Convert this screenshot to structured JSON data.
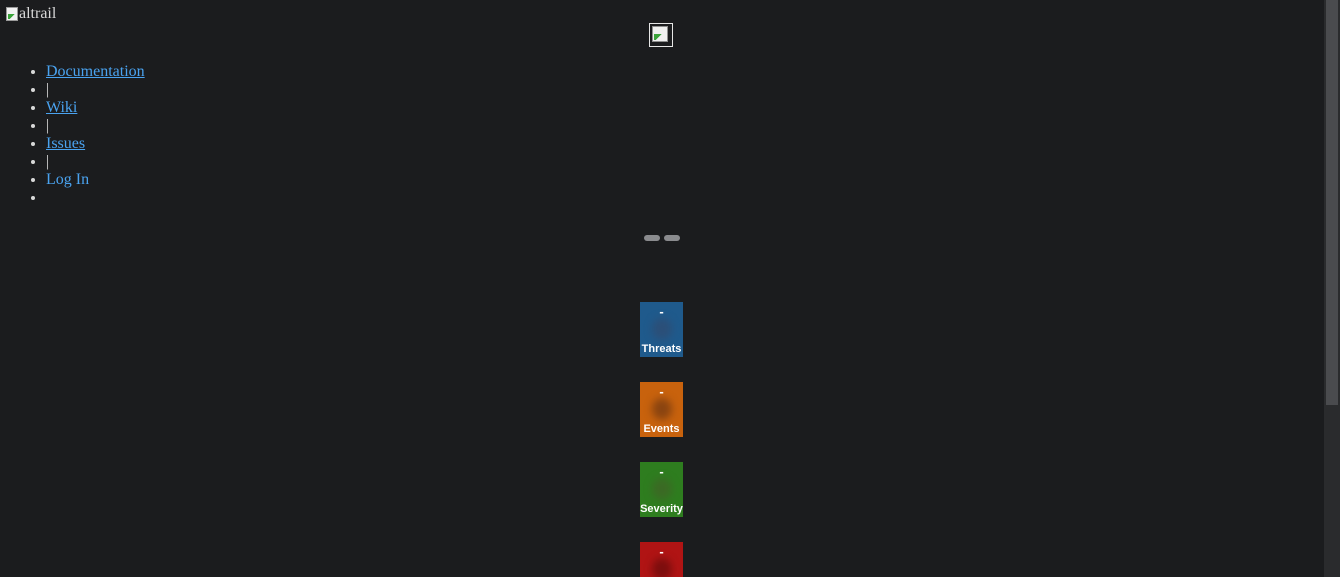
{
  "logo": {
    "alt_text": "altrail"
  },
  "nav": {
    "items": [
      {
        "label": "Documentation"
      },
      {
        "separator": "|"
      },
      {
        "label": "Wiki"
      },
      {
        "separator": "|"
      },
      {
        "label": "Issues"
      },
      {
        "separator": "|"
      },
      {
        "label": "Log In"
      }
    ]
  },
  "stats": [
    {
      "value": "-",
      "label": "Threats",
      "color": "#1f5a8c",
      "glow": "#2b4f78"
    },
    {
      "value": "-",
      "label": "Events",
      "color": "#c8620d",
      "glow": "#8a4410"
    },
    {
      "value": "-",
      "label": "Severity",
      "color": "#2e7d1f",
      "glow": "#3b6a24"
    },
    {
      "value": "-",
      "label": "",
      "color": "#b01414",
      "glow": "#7c0e0e"
    }
  ],
  "icons": {
    "logo": "broken-image-icon",
    "center": "broken-image-icon"
  }
}
